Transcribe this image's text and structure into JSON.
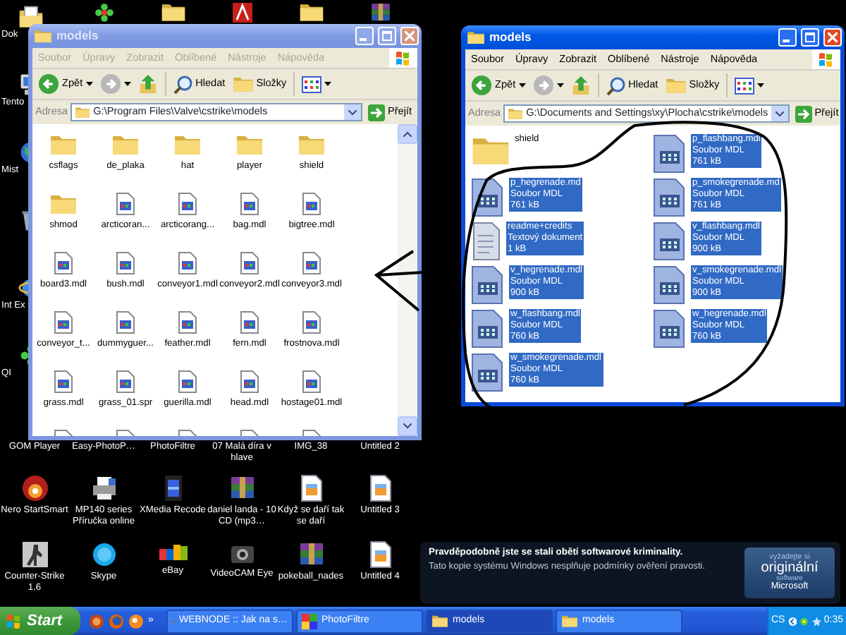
{
  "desktop": {
    "left_column": [
      {
        "label": "Dok",
        "kind": "documents"
      },
      {
        "label": "Tento",
        "kind": "computer"
      },
      {
        "label": "Mist",
        "kind": "network"
      },
      {
        "kind": "bin"
      },
      {
        "label": "Int Ex",
        "kind": "browser"
      },
      {
        "label": "QI",
        "kind": "chat"
      }
    ],
    "icon_rows": [
      [
        {
          "label": "GOM Player"
        },
        {
          "label": "Easy-PhotoP…"
        },
        {
          "label": "PhotoFiltre"
        },
        {
          "label": "07 Malá díra v hlave"
        },
        {
          "label": "IMG_38"
        },
        {
          "label": "Untitled 2"
        }
      ],
      [
        {
          "label": "Nero StartSmart",
          "kind": "disc"
        },
        {
          "label": "MP140 series Příručka online",
          "kind": "printer"
        },
        {
          "label": "XMedia Recode",
          "kind": "film"
        },
        {
          "label": "daniel landa - 10 CD (mp3…",
          "kind": "archive"
        },
        {
          "label": "Když se daří tak se daří",
          "kind": "image"
        },
        {
          "label": "Untitled 3",
          "kind": "image"
        }
      ],
      [
        {
          "label": "Counter-Strike 1.6",
          "kind": "game"
        },
        {
          "label": "Skype",
          "kind": "cloud"
        },
        {
          "label": "eBay",
          "kind": "shop"
        },
        {
          "label": "VideoCAM Eye",
          "kind": "camera"
        },
        {
          "label": "pokeball_nades",
          "kind": "archive"
        },
        {
          "label": "Untitled 4",
          "kind": "image"
        }
      ]
    ]
  },
  "windows": [
    {
      "title": "models",
      "active": false,
      "kind": "icons",
      "menu": [
        "Soubor",
        "Úpravy",
        "Zobrazit",
        "Oblíbené",
        "Nástroje",
        "Nápověda"
      ],
      "toolbar": {
        "back": "Zpět",
        "search": "Hledat",
        "folders": "Složky"
      },
      "address": {
        "label": "Adresa",
        "path": "G:\\Program Files\\Valve\\cstrike\\models",
        "go": "Přejít"
      },
      "items": [
        {
          "name": "csflags",
          "kind": "folder",
          "selected": false
        },
        {
          "name": "de_plaka",
          "kind": "folder",
          "selected": false
        },
        {
          "name": "hat",
          "kind": "folder",
          "selected": false
        },
        {
          "name": "player",
          "kind": "folder",
          "selected": false
        },
        {
          "name": "shield",
          "kind": "folder",
          "selected": false
        },
        {
          "name": "shmod",
          "kind": "folder",
          "selected": false
        },
        {
          "name": "arcticoran...",
          "kind": "file",
          "selected": false
        },
        {
          "name": "arcticorang...",
          "kind": "file",
          "selected": false
        },
        {
          "name": "bag.mdl",
          "kind": "file",
          "selected": false
        },
        {
          "name": "bigtree.mdl",
          "kind": "file",
          "selected": false
        },
        {
          "name": "board3.mdl",
          "kind": "file",
          "selected": false
        },
        {
          "name": "bush.mdl",
          "kind": "file",
          "selected": false
        },
        {
          "name": "conveyor1.mdl",
          "kind": "file",
          "selected": false
        },
        {
          "name": "conveyor2.mdl",
          "kind": "file",
          "selected": false
        },
        {
          "name": "conveyor3.mdl",
          "kind": "file",
          "selected": false
        },
        {
          "name": "conveyor_t...",
          "kind": "file",
          "selected": false
        },
        {
          "name": "dummyguer...",
          "kind": "file",
          "selected": false
        },
        {
          "name": "feather.mdl",
          "kind": "file",
          "selected": false
        },
        {
          "name": "fern.mdl",
          "kind": "file",
          "selected": false
        },
        {
          "name": "frostnova.mdl",
          "kind": "file",
          "selected": false
        },
        {
          "name": "grass.mdl",
          "kind": "file",
          "selected": false
        },
        {
          "name": "grass_01.spr",
          "kind": "file",
          "selected": false
        },
        {
          "name": "guerilla.mdl",
          "kind": "file",
          "selected": false
        },
        {
          "name": "head.mdl",
          "kind": "file",
          "selected": false
        },
        {
          "name": "hostage01.mdl",
          "kind": "file",
          "selected": false
        }
      ]
    },
    {
      "title": "models",
      "active": true,
      "kind": "tiles",
      "menu": [
        "Soubor",
        "Úpravy",
        "Zobrazit",
        "Oblíbené",
        "Nástroje",
        "Nápověda"
      ],
      "toolbar": {
        "back": "Zpět",
        "search": "Hledat",
        "folders": "Složky"
      },
      "address": {
        "label": "Adresa",
        "path": "G:\\Documents and Settings\\xy\\Plocha\\cstrike\\models",
        "go": "Přejít"
      },
      "items": [
        {
          "name": "shield",
          "kind": "folder",
          "selected": false
        },
        {
          "name": "p_flashbang.mdl",
          "type": "Soubor MDL",
          "size": "761 kB",
          "kind": "model",
          "selected": true
        },
        {
          "name": "p_hegrenade.md",
          "type": "Soubor MDL",
          "size": "761 kB",
          "kind": "model",
          "selected": true
        },
        {
          "name": "p_smokegrenade.md",
          "type": "Soubor MDL",
          "size": "761 kB",
          "kind": "model",
          "selected": true
        },
        {
          "name": "readme+credits",
          "type": "Textový dokument",
          "size": "1 kB",
          "kind": "text",
          "selected": true
        },
        {
          "name": "v_flashbang.mdl",
          "type": "Soubor MDL",
          "size": "900 kB",
          "kind": "model",
          "selected": true
        },
        {
          "name": "v_hegrenade.mdl",
          "type": "Soubor MDL",
          "size": "900 kB",
          "kind": "model",
          "selected": true
        },
        {
          "name": "v_smokegrenade.mdl",
          "type": "Soubor MDL",
          "size": "900 kB",
          "kind": "model",
          "selected": true
        },
        {
          "name": "w_flashbang.mdl",
          "type": "Soubor MDL",
          "size": "760 kB",
          "kind": "model",
          "selected": true
        },
        {
          "name": "w_hegrenade.mdl",
          "type": "Soubor MDL",
          "size": "760 kB",
          "kind": "model",
          "selected": true
        },
        {
          "name": "w_smokegrenade.mdl",
          "type": "Soubor MDL",
          "size": "760 kB",
          "kind": "model",
          "selected": true
        }
      ]
    }
  ],
  "notice": {
    "heading": "Pravděpodobně jste se stali obětí softwarové kriminality.",
    "text": "Tato kopie systému Windows nesplňuje podmínky ověření pravosti.",
    "badge": [
      "vyžadejte si",
      "originální",
      "software",
      "Microsoft"
    ]
  },
  "taskbar": {
    "start": "Start",
    "more": "»",
    "tasks": [
      {
        "label": "WEBNODE :: Jak na s…",
        "kind": "browser",
        "selected": false
      },
      {
        "label": "PhotoFiltre",
        "kind": "photo",
        "selected": false
      },
      {
        "label": "models",
        "kind": "folder",
        "selected": true
      },
      {
        "label": "models",
        "kind": "folder",
        "selected": false
      }
    ],
    "language": "CS",
    "clock": "0:35"
  }
}
